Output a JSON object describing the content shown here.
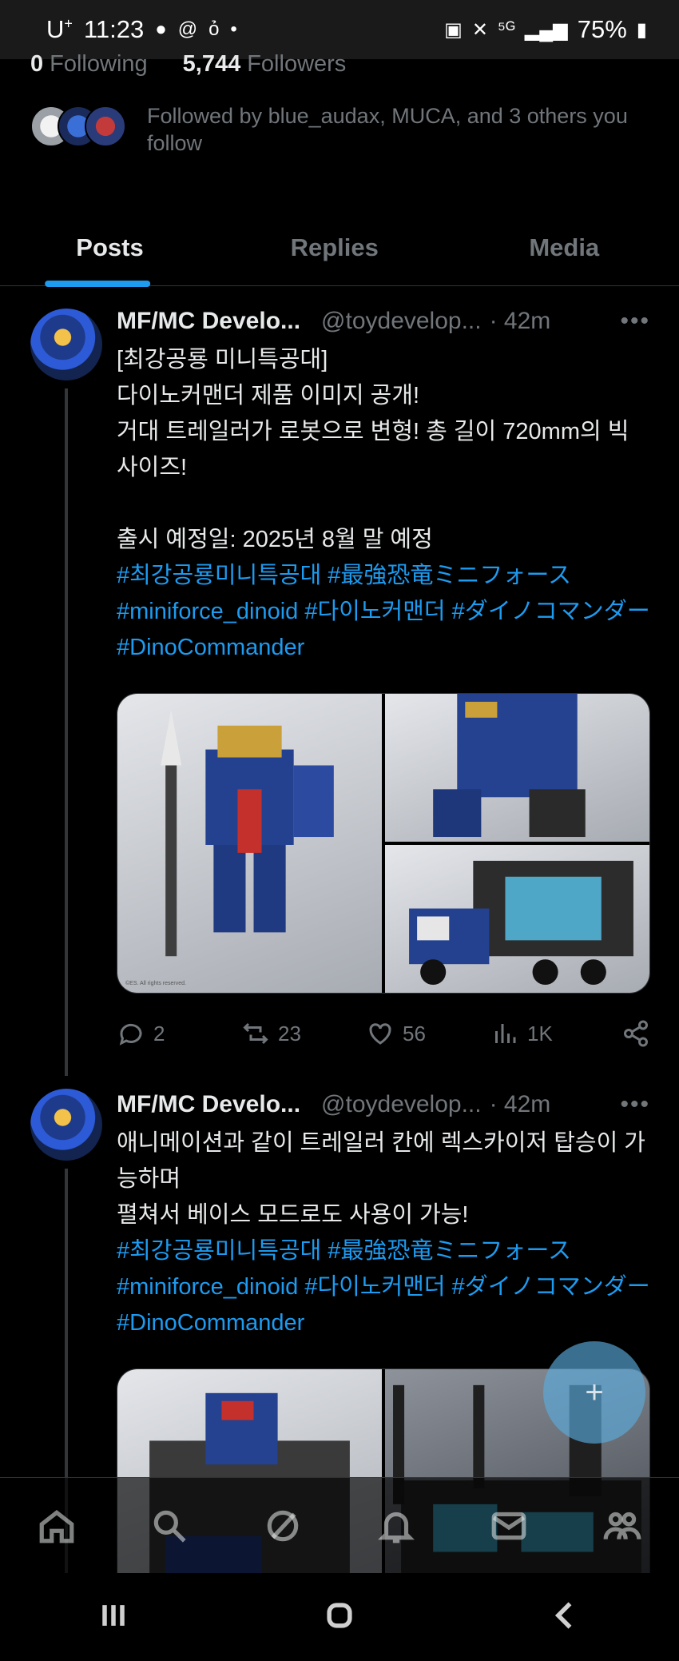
{
  "status_bar": {
    "carrier": "U",
    "carrier_sup": "+",
    "time": "11:23",
    "battery": "75%"
  },
  "profile": {
    "following_count": "0",
    "following_label": "Following",
    "followers_count": "5,744",
    "followers_label": "Followers",
    "followed_by": "Followed by blue_audax, MUCA, and 3 others you follow"
  },
  "tabs": [
    {
      "label": "Posts"
    },
    {
      "label": "Replies"
    },
    {
      "label": "Media"
    }
  ],
  "posts": [
    {
      "name": "MF/MC Develo...",
      "handle": "@toydevelop...",
      "time": "· 42m",
      "more": "•••",
      "lines": [
        "[최강공룡 미니특공대]",
        "다이노커맨더 제품 이미지 공개!",
        "거대 트레일러가 로봇으로 변형! 총 길이 720mm의 빅 사이즈!"
      ],
      "release": "출시 예정일: 2025년 8월 말 예정",
      "hashtags": "#최강공룡미니특공대 #最強恐竜ミニフォース #miniforce_dinoid #다이노커맨더 #ダイノコマンダー #DinoCommander",
      "image_caption": "©ES. All rights reserved.",
      "replies": "2",
      "reposts": "23",
      "likes": "56",
      "views": "1K"
    },
    {
      "name": "MF/MC Develo...",
      "handle": "@toydevelop...",
      "time": "· 42m",
      "more": "•••",
      "lines": [
        "애니메이션과 같이 트레일러 칸에 렉스카이저 탑승이 가능하며",
        "펼쳐서 베이스 모드로도 사용이 가능!"
      ],
      "hashtags": "#최강공룡미니특공대 #最強恐竜ミニフォース #miniforce_dinoid #다이노커맨더 #ダイノコマンダー #DinoCommander"
    }
  ],
  "fab": {
    "icon": "compose-plus-icon",
    "label": "+"
  },
  "bottom_nav": [
    "home-icon",
    "search-icon",
    "grok-icon",
    "notifications-icon",
    "messages-icon",
    "communities-icon"
  ],
  "colors": {
    "accent": "#1d9bf0",
    "muted": "#71767b",
    "text": "#e7e9ea",
    "background": "#000000"
  }
}
